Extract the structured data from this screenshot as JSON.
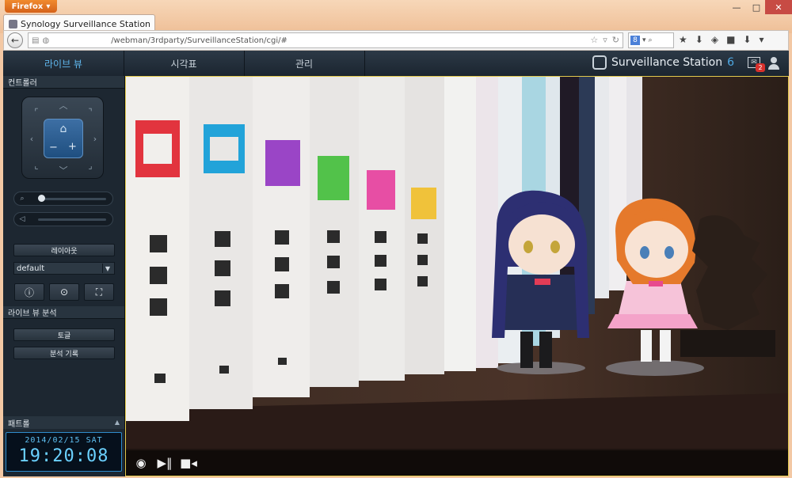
{
  "browser": {
    "menu_label": "Firefox",
    "tab_title": "Synology Surveillance Station",
    "url": "/webman/3rdparty/SurveillanceStation/cgi/#",
    "search_icon_label": "8"
  },
  "app": {
    "tabs": [
      "라이브 뷰",
      "시각표",
      "관리"
    ],
    "brand": {
      "name": "Surveillance Station",
      "version": "6"
    },
    "message_count": "2"
  },
  "sidebar": {
    "controller_title": "컨트롤러",
    "layout_button": "레이아웃",
    "layout_select": "default",
    "analysis_title": "라이브 뷰 분석",
    "toggle_button": "토글",
    "history_button": "분석 기록",
    "patrol_title": "패트롤"
  },
  "clock": {
    "date": "2014/02/15 SAT",
    "time": "19:20:08"
  },
  "colors": {
    "accent": "#5fb7ee",
    "frame": "#f3c8a4",
    "video_border": "#e2c94d"
  }
}
